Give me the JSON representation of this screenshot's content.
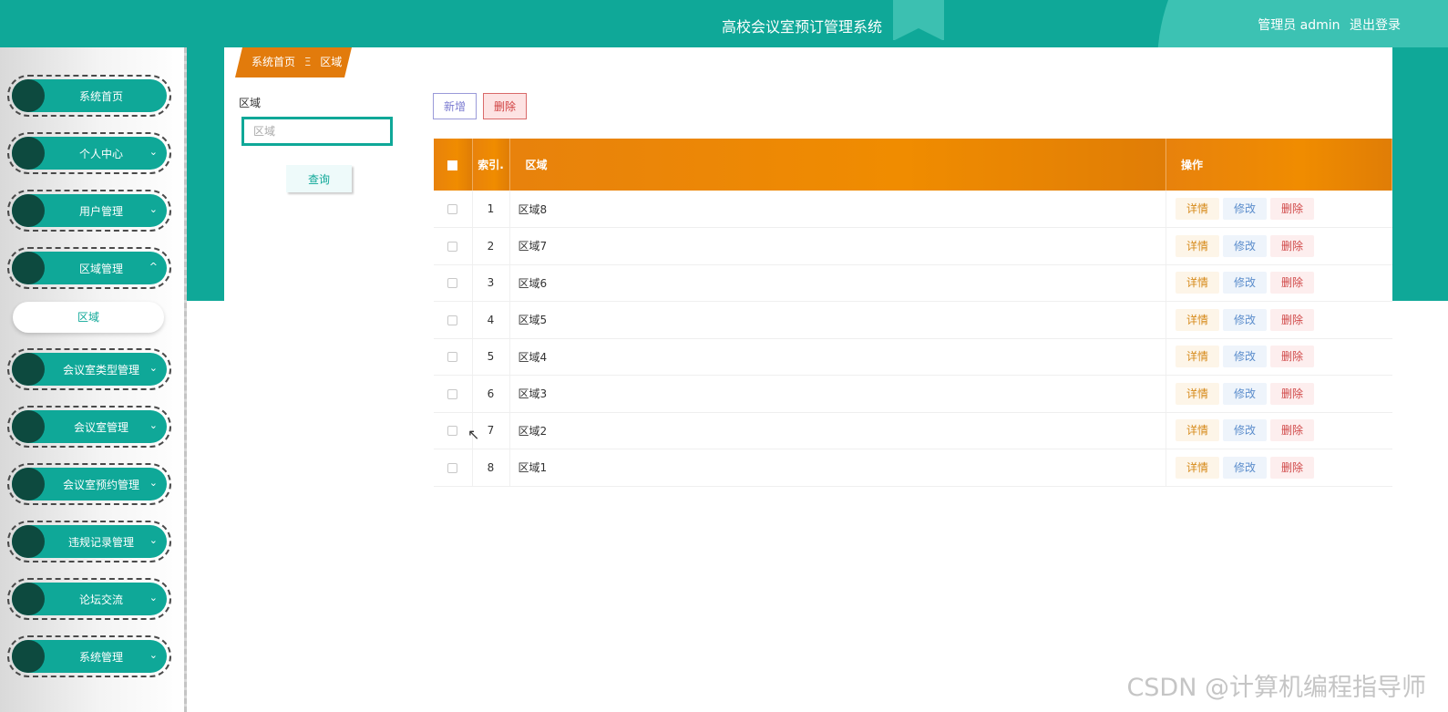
{
  "header": {
    "title": "高校会议室预订管理系统",
    "user_label": "管理员 admin",
    "logout_label": "退出登录"
  },
  "sidebar": {
    "items": [
      {
        "label": "系统首页",
        "chevron": ""
      },
      {
        "label": "个人中心",
        "chevron": "⌄"
      },
      {
        "label": "用户管理",
        "chevron": "⌄"
      },
      {
        "label": "区域管理",
        "chevron": "^"
      },
      {
        "label": "会议室类型管理",
        "chevron": "⌄"
      },
      {
        "label": "会议室管理",
        "chevron": "⌄"
      },
      {
        "label": "会议室预约管理",
        "chevron": "⌄"
      },
      {
        "label": "违规记录管理",
        "chevron": "⌄"
      },
      {
        "label": "论坛交流",
        "chevron": "⌄"
      },
      {
        "label": "系统管理",
        "chevron": "⌄"
      }
    ],
    "sub_item": "区域"
  },
  "breadcrumb": {
    "home": "系统首页",
    "separator": "Ξ",
    "current": "区域"
  },
  "search": {
    "label": "区域",
    "placeholder": "区域",
    "value": "",
    "query_button": "查询"
  },
  "toolbar": {
    "add_label": "新增",
    "delete_label": "删除"
  },
  "table": {
    "headers": {
      "index": "索引.",
      "area": "区域",
      "actions": "操作"
    },
    "actions": {
      "detail": "详情",
      "edit": "修改",
      "delete": "删除"
    },
    "rows": [
      {
        "index": "1",
        "area": "区域8"
      },
      {
        "index": "2",
        "area": "区域7"
      },
      {
        "index": "3",
        "area": "区域6"
      },
      {
        "index": "4",
        "area": "区域5"
      },
      {
        "index": "5",
        "area": "区域4"
      },
      {
        "index": "6",
        "area": "区域3"
      },
      {
        "index": "7",
        "area": "区域2"
      },
      {
        "index": "8",
        "area": "区域1"
      }
    ]
  },
  "watermark": "CSDN @计算机编程指导师",
  "colors": {
    "primary": "#0fa898",
    "header_orange": "#f08c00",
    "breadcrumb_orange": "#e27b0c",
    "dark_dot": "#0d4a3f"
  }
}
